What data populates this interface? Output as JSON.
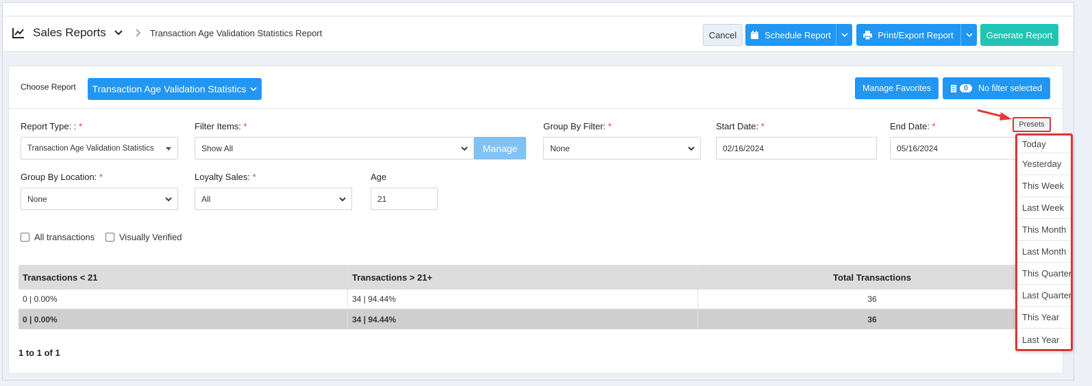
{
  "header": {
    "title": "Sales Reports",
    "breadcrumb": "Transaction Age Validation Statistics Report",
    "cancel_label": "Cancel",
    "schedule_label": "Schedule Report",
    "print_label": "Print/Export Report",
    "generate_label": "Generate Report"
  },
  "report": {
    "choose_label": "Choose Report",
    "selected": "Transaction Age Validation Statistics",
    "manage_favorites": "Manage Favorites",
    "filter_count": "0",
    "filter_label": "No filter selected"
  },
  "filters": {
    "report_type_label": "Report Type: :",
    "report_type_value": "Transaction Age Validation Statistics",
    "filter_items_label": "Filter Items:",
    "filter_items_value": "Show All",
    "manage_label": "Manage",
    "group_by_filter_label": "Group By Filter:",
    "group_by_filter_value": "None",
    "start_date_label": "Start Date:",
    "start_date_value": "02/16/2024",
    "end_date_label": "End Date:",
    "end_date_value": "05/16/2024",
    "group_by_location_label": "Group By Location:",
    "group_by_location_value": "None",
    "loyalty_sales_label": "Loyalty Sales:",
    "loyalty_sales_value": "All",
    "age_label": "Age",
    "age_value": "21",
    "required_mark": "*",
    "all_transactions_label": "All transactions",
    "visually_verified_label": "Visually Verified",
    "presets_label": "Presets"
  },
  "table": {
    "headers": [
      "Transactions < 21",
      "Transactions > 21+",
      "Total Transactions"
    ],
    "rows": [
      [
        "0 | 0.00%",
        "34 | 94.44%",
        "36"
      ]
    ],
    "totals": [
      "0 | 0.00%",
      "34 | 94.44%",
      "36"
    ]
  },
  "pager": "1 to 1 of 1",
  "presets": [
    "Today",
    "Yesterday",
    "This Week",
    "Last Week",
    "This Month",
    "Last Month",
    "This Quarter",
    "Last Quarter",
    "This Year",
    "Last Year"
  ],
  "colors": {
    "primary": "#2196f3",
    "teal": "#1ec4b4",
    "highlight": "#d93438"
  }
}
